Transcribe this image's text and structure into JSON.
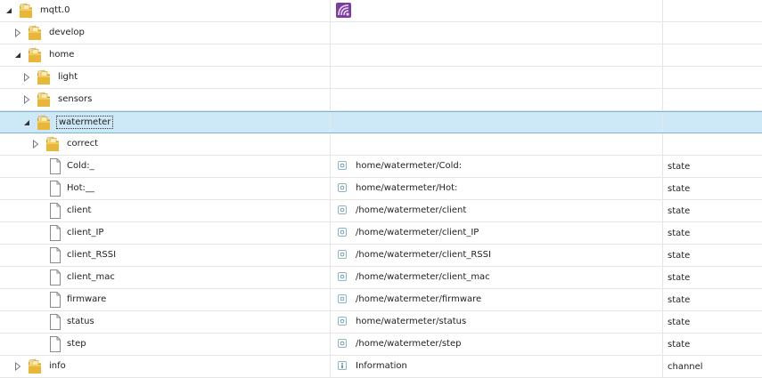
{
  "rows": [
    {
      "label": "mqtt.0",
      "depth": 0,
      "kind": "folder",
      "toggle": "open",
      "adapter_icon": true,
      "id": "",
      "type": ""
    },
    {
      "label": "develop",
      "depth": 1,
      "kind": "folder",
      "toggle": "closed",
      "id": "",
      "type": ""
    },
    {
      "label": "home",
      "depth": 1,
      "kind": "folder",
      "toggle": "open",
      "id": "",
      "type": ""
    },
    {
      "label": "light",
      "depth": 2,
      "kind": "folder",
      "toggle": "closed",
      "id": "",
      "type": ""
    },
    {
      "label": "sensors",
      "depth": 2,
      "kind": "folder",
      "toggle": "closed",
      "id": "",
      "type": ""
    },
    {
      "label": "watermeter",
      "depth": 2,
      "kind": "folder",
      "toggle": "open",
      "selected": true,
      "id": "",
      "type": ""
    },
    {
      "label": "correct",
      "depth": 3,
      "kind": "folder",
      "toggle": "closed",
      "id": "",
      "type": ""
    },
    {
      "label": "Cold:_",
      "depth": 3,
      "kind": "file",
      "id": "home/watermeter/Cold:",
      "id_icon": "state-icon",
      "type": "state"
    },
    {
      "label": "Hot:__",
      "depth": 3,
      "kind": "file",
      "id": "home/watermeter/Hot:",
      "id_icon": "state-icon",
      "type": "state"
    },
    {
      "label": "client",
      "depth": 3,
      "kind": "file",
      "id": "/home/watermeter/client",
      "id_icon": "state-icon",
      "type": "state"
    },
    {
      "label": "client_IP",
      "depth": 3,
      "kind": "file",
      "id": "/home/watermeter/client_IP",
      "id_icon": "state-icon",
      "type": "state"
    },
    {
      "label": "client_RSSI",
      "depth": 3,
      "kind": "file",
      "id": "/home/watermeter/client_RSSI",
      "id_icon": "state-icon",
      "type": "state"
    },
    {
      "label": "client_mac",
      "depth": 3,
      "kind": "file",
      "id": "/home/watermeter/client_mac",
      "id_icon": "state-icon",
      "type": "state"
    },
    {
      "label": "firmware",
      "depth": 3,
      "kind": "file",
      "id": "/home/watermeter/firmware",
      "id_icon": "state-icon",
      "type": "state"
    },
    {
      "label": "status",
      "depth": 3,
      "kind": "file",
      "id": "home/watermeter/status",
      "id_icon": "state-icon",
      "type": "state"
    },
    {
      "label": "step",
      "depth": 3,
      "kind": "file",
      "id": "/home/watermeter/step",
      "id_icon": "state-icon",
      "type": "state"
    },
    {
      "label": "info",
      "depth": 1,
      "kind": "folder",
      "toggle": "closed",
      "id": "Information",
      "id_icon": "info-icon",
      "type": "channel"
    }
  ],
  "colors": {
    "selected_bg": "#cde8f6",
    "selected_border": "#7ab8d6",
    "folder": "#e8b73a",
    "state_icon": "#4fa3c8",
    "grid_line": "#e6e6e6"
  }
}
